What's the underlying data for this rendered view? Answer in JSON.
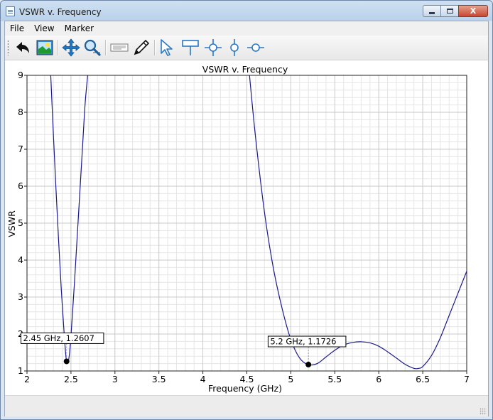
{
  "window": {
    "title": "VSWR v. Frequency",
    "caption": {
      "close_label": "X"
    }
  },
  "menu": {
    "items": [
      {
        "label": "File"
      },
      {
        "label": "View"
      },
      {
        "label": "Marker"
      }
    ]
  },
  "toolbar": {
    "icons": [
      "back-arrow-icon",
      "image-export-icon",
      "pan-move-icon",
      "zoom-magnifier-icon",
      "edit-textbox-icon",
      "pencil-icon",
      "pointer-select-icon",
      "marker-flag-icon",
      "marker-crosshair-icon",
      "marker-vertical-icon",
      "marker-horizontal-icon"
    ]
  },
  "colors": {
    "curve": "#1a1a8c",
    "grid_major": "#c8c8c8",
    "grid_minor": "#e6e6e6"
  },
  "chart_data": {
    "type": "line",
    "title": "VSWR v. Frequency",
    "xlabel": "Frequency (GHz)",
    "ylabel": "VSWR",
    "xlim": [
      2,
      7
    ],
    "ylim": [
      1,
      9
    ],
    "xticks": [
      "2",
      "2.5",
      "3",
      "3.5",
      "4",
      "4.5",
      "5",
      "5.5",
      "6",
      "6.5",
      "7"
    ],
    "yticks": [
      "1",
      "2",
      "3",
      "4",
      "5",
      "6",
      "7",
      "8",
      "9"
    ],
    "grid": true,
    "series": [
      {
        "x": [
          2.27,
          2.3,
          2.33,
          2.36,
          2.39,
          2.42,
          2.45,
          2.48,
          2.51,
          2.54,
          2.57,
          2.6,
          2.63,
          2.66,
          2.69
        ],
        "y": [
          9.0,
          7.4,
          5.9,
          4.5,
          3.2,
          2.1,
          1.26,
          1.4,
          2.3,
          3.4,
          4.6,
          5.8,
          7.0,
          8.2,
          9.0
        ]
      },
      {
        "x": [
          4.53,
          4.6,
          4.7,
          4.8,
          4.9,
          5.0,
          5.1,
          5.2,
          5.3,
          5.4,
          5.5,
          5.6,
          5.7,
          5.8,
          5.9,
          6.0,
          6.1,
          6.2,
          6.3,
          6.4,
          6.45,
          6.5,
          6.6,
          6.7,
          6.8,
          6.9,
          7.0
        ],
        "y": [
          9.0,
          7.3,
          5.3,
          3.8,
          2.7,
          1.85,
          1.35,
          1.17,
          1.2,
          1.38,
          1.56,
          1.7,
          1.77,
          1.79,
          1.76,
          1.67,
          1.52,
          1.35,
          1.18,
          1.07,
          1.07,
          1.12,
          1.42,
          1.9,
          2.5,
          3.1,
          3.7
        ]
      }
    ],
    "markers": [
      {
        "x": 2.45,
        "y": 1.2607,
        "label": "2.45 GHz, 1.2607"
      },
      {
        "x": 5.2,
        "y": 1.1726,
        "label": "5.2 GHz, 1.1726"
      }
    ]
  }
}
